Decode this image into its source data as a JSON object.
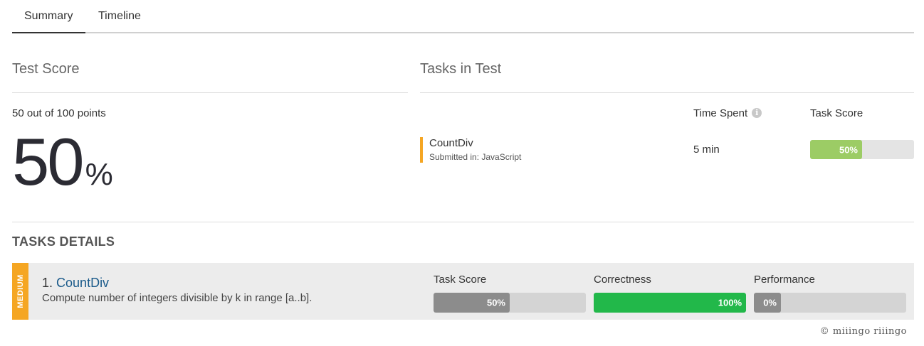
{
  "tabs": [
    {
      "label": "Summary",
      "active": true
    },
    {
      "label": "Timeline",
      "active": false
    }
  ],
  "test_score": {
    "title": "Test Score",
    "points_text": "50 out of 100 points",
    "percent_value": "50",
    "percent_sign": "%"
  },
  "tasks_in_test": {
    "title": "Tasks in Test",
    "time_spent_header": "Time Spent",
    "task_score_header": "Task Score",
    "info_icon": "info-icon",
    "task": {
      "name": "CountDiv",
      "submitted": "Submitted in: JavaScript",
      "time_spent": "5 min",
      "score_label": "50%",
      "score_fraction": 0.5
    }
  },
  "tasks_details": {
    "title": "TASKS DETAILS",
    "task": {
      "difficulty": "MEDIUM",
      "number": "1.",
      "name": "CountDiv",
      "description": "Compute number of integers divisible by k in range [a..b].",
      "metrics": [
        {
          "header": "Task Score",
          "label": "50%",
          "fraction": 0.5,
          "color": "#8c8c8c"
        },
        {
          "header": "Correctness",
          "label": "100%",
          "fraction": 1.0,
          "color": "#22b84a"
        },
        {
          "header": "Performance",
          "label": "0%",
          "fraction": 0.0,
          "color": "#8c8c8c"
        }
      ]
    }
  },
  "colors": {
    "accent_orange": "#f5a623",
    "score_green": "#9ccc65",
    "link_blue": "#1a5a8a"
  },
  "footer": {
    "brand": "© miiingo riiingo"
  }
}
